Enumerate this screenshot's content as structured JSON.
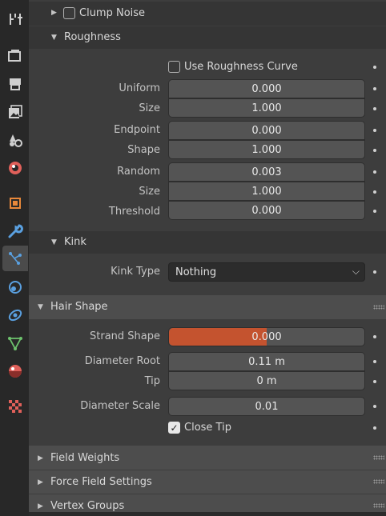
{
  "tabs": [
    {
      "name": "tool-icon",
      "color": "#cfcfcf"
    },
    {
      "name": "render-icon",
      "color": "#cfcfcf"
    },
    {
      "name": "output-icon",
      "color": "#cfcfcf"
    },
    {
      "name": "view-layer-icon",
      "color": "#cfcfcf"
    },
    {
      "name": "scene-icon",
      "color": "#cfcfcf"
    },
    {
      "name": "world-icon",
      "color": "#e0605a"
    },
    {
      "name": "object-icon",
      "color": "#e8883a"
    },
    {
      "name": "modifier-icon",
      "color": "#5aa0e0"
    },
    {
      "name": "particles-icon",
      "color": "#5aa0e0",
      "active": true
    },
    {
      "name": "physics-icon",
      "color": "#5aa0e0"
    },
    {
      "name": "constraints-icon",
      "color": "#5aa0e0"
    },
    {
      "name": "data-icon",
      "color": "#6dc26d"
    },
    {
      "name": "material-icon",
      "color": "#e0605a"
    },
    {
      "name": "texture-icon",
      "color": "#e0605a"
    }
  ],
  "clump_noise": {
    "label": "Clump Noise",
    "checked": false
  },
  "roughness": {
    "title": "Roughness",
    "use_curve_label": "Use Roughness Curve",
    "uniform_label": "Uniform",
    "uniform_value": "0.000",
    "uniform_size_label": "Size",
    "uniform_size_value": "1.000",
    "endpoint_label": "Endpoint",
    "endpoint_value": "0.000",
    "shape_label": "Shape",
    "shape_value": "1.000",
    "random_label": "Random",
    "random_value": "0.003",
    "random_size_label": "Size",
    "random_size_value": "1.000",
    "threshold_label": "Threshold",
    "threshold_value": "0.000"
  },
  "kink": {
    "title": "Kink",
    "type_label": "Kink Type",
    "type_value": "Nothing"
  },
  "hair_shape": {
    "title": "Hair Shape",
    "strand_shape_label": "Strand Shape",
    "strand_shape_value": "0.000",
    "strand_shape_fill": 0.5,
    "diameter_root_label": "Diameter Root",
    "diameter_root_value": "0.11 m",
    "tip_label": "Tip",
    "tip_value": "0 m",
    "diameter_scale_label": "Diameter Scale",
    "diameter_scale_value": "0.01",
    "close_tip_label": "Close Tip",
    "close_tip_checked": true
  },
  "collapsed_panels": {
    "field_weights": "Field Weights",
    "force_field_settings": "Force Field Settings",
    "vertex_groups": "Vertex Groups"
  },
  "colors": {
    "accent": "#c4532f",
    "background": "#3d3d3d",
    "tab_strip": "#282828"
  }
}
